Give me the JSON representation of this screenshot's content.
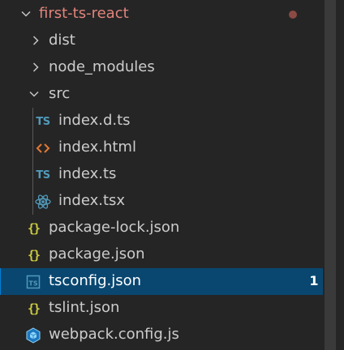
{
  "explorer": {
    "root": {
      "label": "first-ts-react",
      "expanded": true
    },
    "items": [
      {
        "label": "dist",
        "type": "folder",
        "expanded": false,
        "icon": "chevron-right-icon"
      },
      {
        "label": "node_modules",
        "type": "folder",
        "expanded": false,
        "icon": "chevron-right-icon"
      },
      {
        "label": "src",
        "type": "folder",
        "expanded": true,
        "icon": "chevron-down-icon"
      },
      {
        "label": "index.d.ts",
        "type": "file",
        "icon": "typescript-icon",
        "icon_text": "TS"
      },
      {
        "label": "index.html",
        "type": "file",
        "icon": "html-icon",
        "icon_text": "<>"
      },
      {
        "label": "index.ts",
        "type": "file",
        "icon": "typescript-icon",
        "icon_text": "TS"
      },
      {
        "label": "index.tsx",
        "type": "file",
        "icon": "react-icon"
      },
      {
        "label": "package-lock.json",
        "type": "file",
        "icon": "json-icon",
        "icon_text": "{}"
      },
      {
        "label": "package.json",
        "type": "file",
        "icon": "json-icon",
        "icon_text": "{}"
      },
      {
        "label": "tsconfig.json",
        "type": "file",
        "icon": "tsconfig-icon",
        "icon_text": "TS",
        "selected": true,
        "badge": "1"
      },
      {
        "label": "tslint.json",
        "type": "file",
        "icon": "json-icon",
        "icon_text": "{}"
      },
      {
        "label": "webpack.config.js",
        "type": "file",
        "icon": "webpack-icon"
      }
    ]
  },
  "colors": {
    "background": "#252526",
    "selected": "#094771",
    "root_label": "#e2847a",
    "ts_icon": "#519aba",
    "json_icon": "#cbcb41",
    "html_icon": "#e37933",
    "react_icon": "#519aba",
    "webpack_icon": "#519aba",
    "modified_dot": "#8c4a44"
  }
}
